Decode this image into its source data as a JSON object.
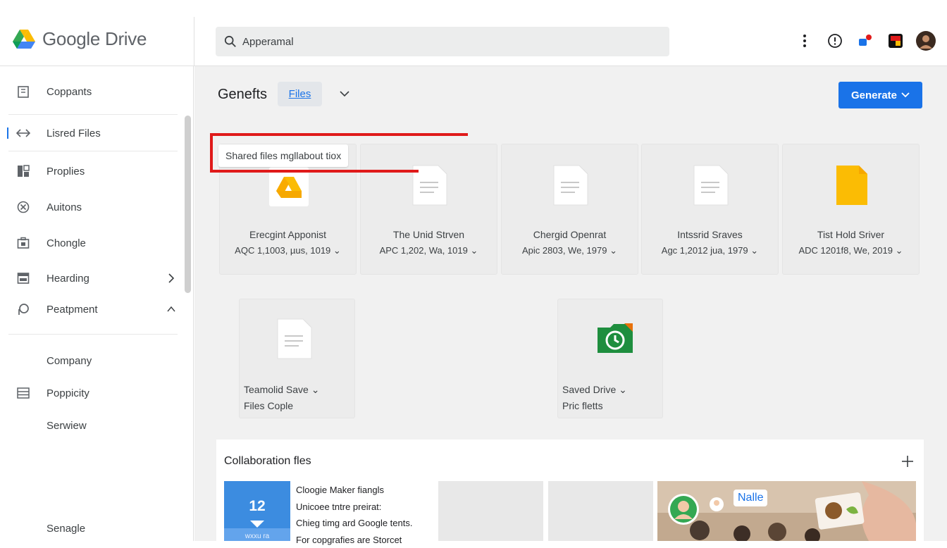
{
  "app": {
    "logo_text": "Google Drive",
    "search_value": "Apperamal"
  },
  "sidebar": {
    "items": [
      {
        "label": "Coppants",
        "icon": "building-icon"
      },
      {
        "label": "Lisred Files",
        "icon": "arrows-icon",
        "active": true
      },
      {
        "label": "Proplies",
        "icon": "grid-icon"
      },
      {
        "label": "Auitons",
        "icon": "circle-x-icon"
      },
      {
        "label": "Chongle",
        "icon": "briefcase-icon"
      },
      {
        "label": "Hearding",
        "icon": "inbox-icon"
      },
      {
        "label": "Peatpment",
        "icon": "pin-icon"
      },
      {
        "label": "Company"
      },
      {
        "label": "Poppicity",
        "icon": "list-icon"
      },
      {
        "label": "Serwiew"
      },
      {
        "label": "Senagle"
      }
    ]
  },
  "header": {
    "title": "Genefts",
    "tab_label": "Files",
    "generate_label": "Generate"
  },
  "tooltip": "Shared files mgllabout tiox",
  "files_row1": [
    {
      "name": "Erecgint Apponist",
      "meta": "AQC 1,1003, µus, 1019",
      "icon": "drive-logo-icon"
    },
    {
      "name": "The Unid Strven",
      "meta": "APC 1,202, Wa, 1019",
      "icon": "document-icon"
    },
    {
      "name": "Chergid Openrat",
      "meta": "Apic 2803, We, 1979",
      "icon": "document-icon"
    },
    {
      "name": "Intssrid Sraves",
      "meta": "Agc 1,2012 jua, 1979",
      "icon": "document-icon"
    },
    {
      "name": "Tist Hold Sriver",
      "meta": "ADC 1201f8, We, 2019",
      "icon": "yellow-file-icon"
    }
  ],
  "files_row2": [
    {
      "name": "Teamolid Save",
      "meta": "Files Cople",
      "icon": "document-icon"
    },
    {
      "name": "Saved Drive",
      "meta": "Pric fletts",
      "icon": "green-clock-folder-icon"
    }
  ],
  "collaboration": {
    "title": "Collaboration fles",
    "date_number": "12",
    "date_sub": "wxxu ra",
    "lines": [
      "Cloogie Maker fiangls",
      "Unicoee tntre preirat:",
      "Chieg timg ard Google tents.",
      "For copgrafies are Storcet"
    ],
    "photo_badge": "Nalle"
  },
  "colors": {
    "accent": "#1a73e8",
    "highlight": "#e01a1a",
    "folder_yellow": "#fbbc04",
    "folder_green": "#1e8e3e"
  }
}
